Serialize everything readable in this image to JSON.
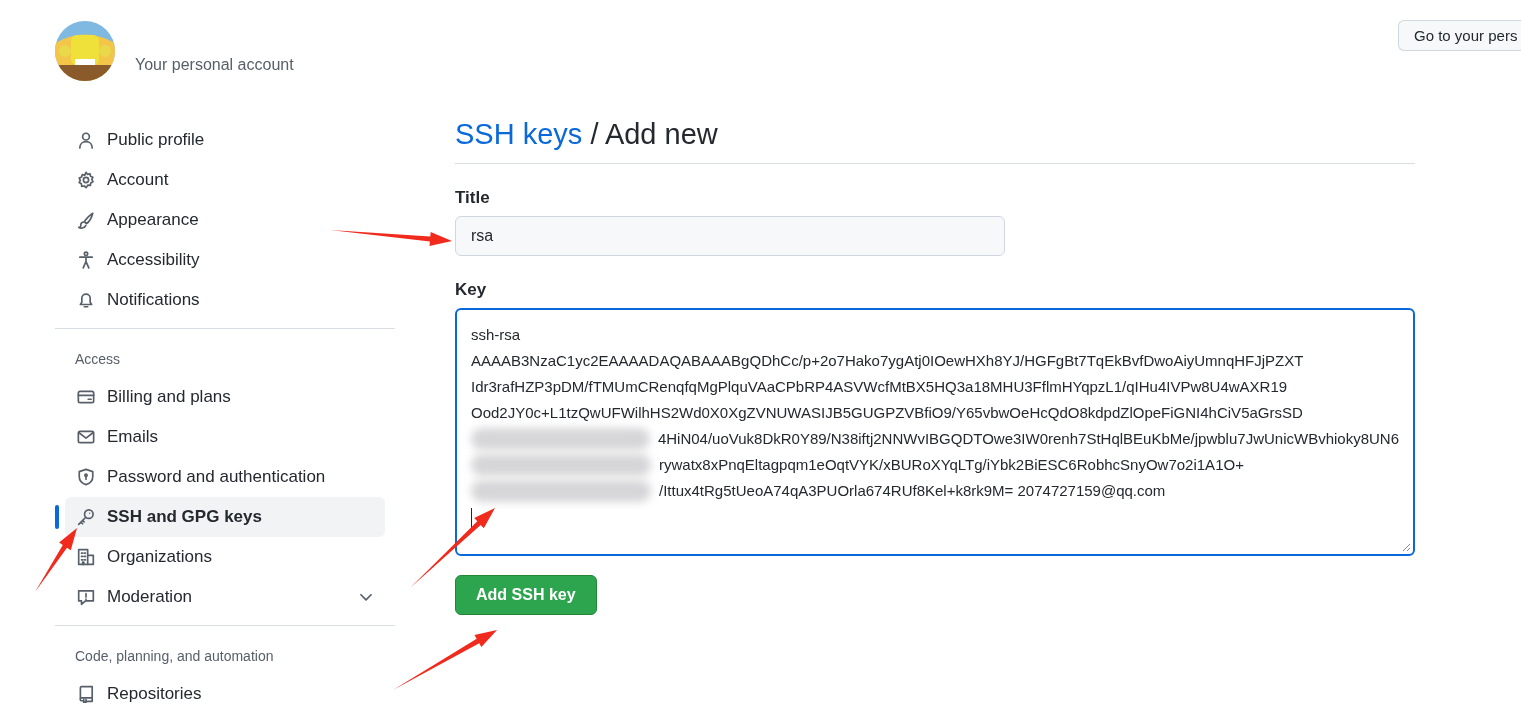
{
  "header": {
    "subtitle": "Your personal account",
    "button": "Go to your pers"
  },
  "sidebar": {
    "groups": [
      {
        "items": [
          {
            "label": "Public profile",
            "selected": false
          },
          {
            "label": "Account",
            "selected": false
          },
          {
            "label": "Appearance",
            "selected": false
          },
          {
            "label": "Accessibility",
            "selected": false
          },
          {
            "label": "Notifications",
            "selected": false
          }
        ]
      },
      {
        "heading": "Access",
        "items": [
          {
            "label": "Billing and plans",
            "selected": false
          },
          {
            "label": "Emails",
            "selected": false
          },
          {
            "label": "Password and authentication",
            "selected": false
          },
          {
            "label": "SSH and GPG keys",
            "selected": true
          },
          {
            "label": "Organizations",
            "selected": false
          },
          {
            "label": "Moderation",
            "selected": false,
            "expandable": true
          }
        ]
      },
      {
        "heading": "Code, planning, and automation",
        "items": [
          {
            "label": "Repositories",
            "selected": false
          }
        ]
      }
    ]
  },
  "main": {
    "breadcrumb_link": "SSH keys",
    "heading": " / Add new",
    "title_label": "Title",
    "title_value": "rsa",
    "key_label": "Key",
    "key_lines": [
      {
        "text": "ssh-rsa",
        "redacted": false
      },
      {
        "text": "AAAAB3NzaC1yc2EAAAADAQABAAABgQDhCc/p+2o7Hako7ygAtj0IOewHXh8YJ/HGFgBt7TqEkBvfDwoAiyUmnqHFJjPZXT",
        "redacted": false
      },
      {
        "text": "Idr3rafHZP3pDM/fTMUmCRenqfqMgPlquVAaCPbRP4ASVWcfMtBX5HQ3a18MHU3FflmHYqpzL1/qIHu4IVPw8U4wAXR19",
        "redacted": false
      },
      {
        "text": "Ood2JY0c+L1tzQwUFWilhHS2Wd0X0XgZVNUWASIJB5GUGPZVBfiO9/Y65vbwOeHcQdO8kdpdZlOpeFiGNI4hCiV5aGrsSD",
        "redacted": false
      },
      {
        "text": "4HiN04/uoVuk8DkR0Y89/N38iftj2NNWvIBGQDTOwe3IW0renh7StHqlBEuKbMe/jpwblu7JwUnicWBvhioky8UN6",
        "redacted": true
      },
      {
        "text": "rywatx8xPnqEltagpqm1eOqtVYK/xBURoXYqLTg/iYbk2BiESC6RobhcSnyOw7o2i1A1O+",
        "redacted": true
      },
      {
        "text": "/Ittux4tRg5tUeoA74qA3PUOrla674RUf8Kel+k8rk9M= 2074727159@qq.com",
        "redacted": true
      }
    ],
    "submit": "Add SSH key"
  }
}
